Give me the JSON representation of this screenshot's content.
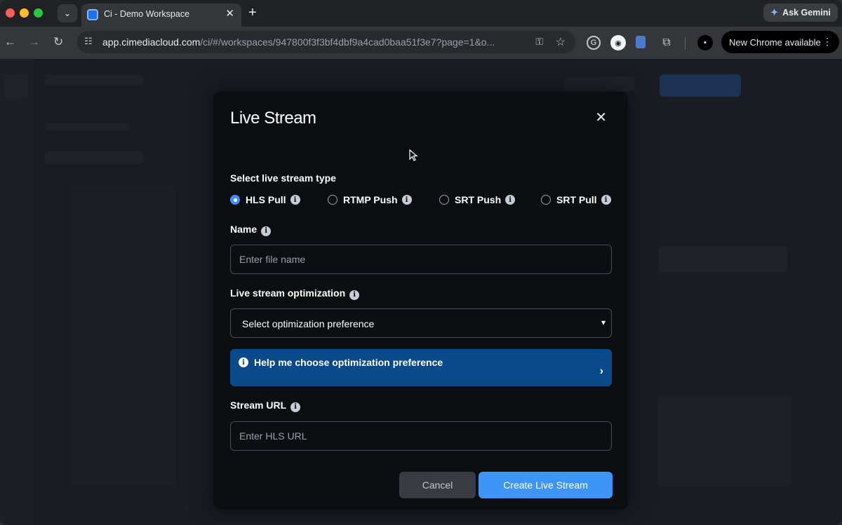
{
  "browser": {
    "tab_title": "Ci - Demo Workspace",
    "tab_close": "✕",
    "new_tab": "+",
    "gemini_label": "Ask Gemini",
    "url_host": "app.cimediacloud.com",
    "url_path": "/ci/#/workspaces/947800f3f3bf4dbf9a4cad0baa51f3e7?page=1&o...",
    "update_label": "New Chrome available"
  },
  "modal": {
    "title": "Live Stream",
    "close": "✕",
    "type_label": "Select live stream type",
    "stream_types": [
      {
        "label": "HLS Pull",
        "selected": true
      },
      {
        "label": "RTMP Push",
        "selected": false
      },
      {
        "label": "SRT Push",
        "selected": false
      },
      {
        "label": "SRT Pull",
        "selected": false
      }
    ],
    "name_label": "Name",
    "name_value": "",
    "name_placeholder": "Enter file name",
    "optimization_label": "Live stream optimization",
    "optimization_value": "Select optimization preference",
    "help_text": "Help me choose optimization preference",
    "stream_url_label": "Stream URL",
    "stream_url_value": "",
    "stream_url_placeholder": "Enter HLS URL",
    "cancel_label": "Cancel",
    "create_label": "Create Live Stream"
  },
  "colors": {
    "accent": "#3d95f5",
    "help_banner": "#0b4a8a",
    "modal_bg": "#0d0e11"
  }
}
